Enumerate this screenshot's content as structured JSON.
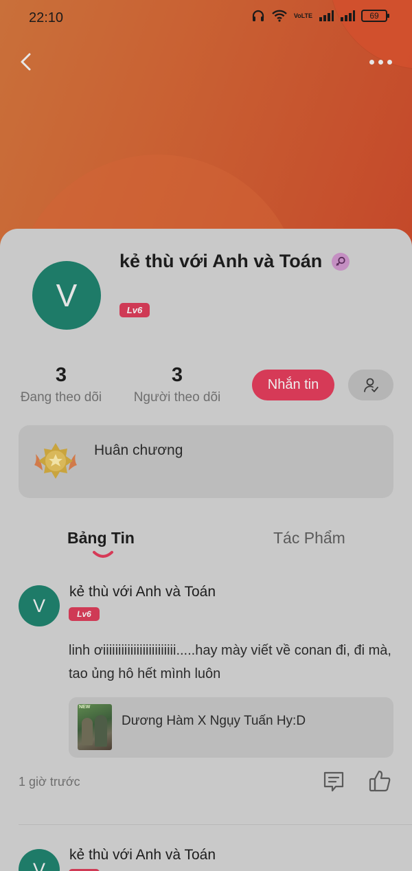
{
  "status_bar": {
    "time": "22:10",
    "network_label": "VoLTE",
    "battery": "69"
  },
  "profile": {
    "avatar_letter": "V",
    "name": "kẻ thù với Anh và Toán",
    "level": "Lv6",
    "following_count": "3",
    "following_label": "Đang theo dõi",
    "followers_count": "3",
    "followers_label": "Người theo dõi",
    "message_button": "Nhắn tin",
    "medal_label": "Huân chương"
  },
  "tabs": [
    {
      "label": "Bảng Tin",
      "active": true
    },
    {
      "label": "Tác Phẩm",
      "active": false
    }
  ],
  "posts": [
    {
      "avatar_letter": "V",
      "author": "kẻ thù với Anh và Toán",
      "level": "Lv6",
      "text": "linh ơiiiiiiiiiiiiiiiiiiiiiiii.....hay mày viết về conan đi, đi mà, tao ủng hô hết mình luôn",
      "story_badge": "NEW",
      "story_title": "Dương Hàm X Ngụy Tuấn Hy:D",
      "time": "1 giờ trước"
    },
    {
      "avatar_letter": "V",
      "author": "kẻ thù với Anh và Toán"
    }
  ],
  "colors": {
    "accent": "#d63a57",
    "avatar": "#1e7b68",
    "header_orange": "#c9613a"
  },
  "icons": [
    "back-arrow-icon",
    "more-icon",
    "headphones-icon",
    "wifi-icon",
    "signal-icon",
    "battery-icon",
    "female-icon",
    "follow-user-icon",
    "medal-icon",
    "comment-icon",
    "like-icon"
  ]
}
